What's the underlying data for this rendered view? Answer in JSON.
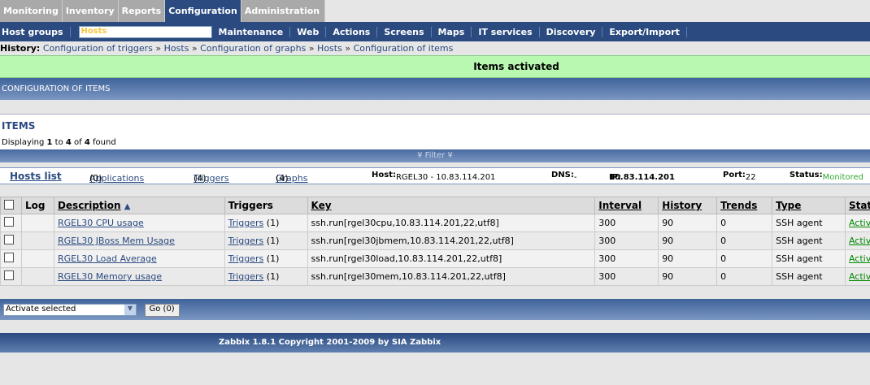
{
  "tabs": [
    "Monitoring",
    "Inventory",
    "Reports",
    "Configuration",
    "Administration"
  ],
  "subnav": [
    "Host groups",
    "Hosts",
    "Maintenance",
    "Web",
    "Actions",
    "Screens",
    "Maps",
    "IT services",
    "Discovery",
    "Export/Import"
  ],
  "history": {
    "label": "History:",
    "items": [
      "Configuration of triggers",
      "Hosts",
      "Configuration of graphs",
      "Hosts",
      "Configuration of items"
    ]
  },
  "message": "Items activated",
  "section_header": "CONFIGURATION OF ITEMS",
  "items_title": "ITEMS",
  "displaying": {
    "a": "Displaying ",
    "from": "1",
    "b": " to ",
    "to": "4",
    "c": " of ",
    "total": "4",
    "d": " found"
  },
  "filter": "¥  Filter  ¥",
  "hostinfo": {
    "hosts_list": "Hosts list",
    "applications": "Applications",
    "applications_count": "(0)",
    "triggers": "Triggers",
    "triggers_count": "(4)",
    "graphs": "Graphs",
    "graphs_count": "(4)",
    "host_label": "Host:",
    "host": "RGEL30 - 10.83.114.201",
    "dns_label": "DNS:",
    "dns": "-",
    "ip_label": "IP:",
    "ip": "10.83.114.201",
    "port_label": "Port:",
    "port": "22",
    "status_label": "Status:",
    "status": "Monitored"
  },
  "columns": [
    "Log",
    "Description",
    "Triggers",
    "Key",
    "Interval",
    "History",
    "Trends",
    "Type",
    "Status"
  ],
  "rows": [
    {
      "description": "RGEL30 CPU usage",
      "triggers": "Triggers",
      "tcount": "(1)",
      "key": "ssh.run[rgel30cpu,10.83.114.201,22,utf8]",
      "interval": "300",
      "history": "90",
      "trends": "0",
      "type": "SSH agent",
      "status": "Active"
    },
    {
      "description": "RGEL30 JBoss Mem Usage",
      "triggers": "Triggers",
      "tcount": "(1)",
      "key": "ssh.run[rgel30jbmem,10.83.114.201,22,utf8]",
      "interval": "300",
      "history": "90",
      "trends": "0",
      "type": "SSH agent",
      "status": "Active"
    },
    {
      "description": "RGEL30 Load Average",
      "triggers": "Triggers",
      "tcount": "(1)",
      "key": "ssh.run[rgel30load,10.83.114.201,22,utf8]",
      "interval": "300",
      "history": "90",
      "trends": "0",
      "type": "SSH agent",
      "status": "Active"
    },
    {
      "description": "RGEL30 Memory usage",
      "triggers": "Triggers",
      "tcount": "(1)",
      "key": "ssh.run[rgel30mem,10.83.114.201,22,utf8]",
      "interval": "300",
      "history": "90",
      "trends": "0",
      "type": "SSH agent",
      "status": "Active"
    }
  ],
  "action_select": "Activate selected",
  "go_button": "Go (0)",
  "footer": "Zabbix 1.8.1 Copyright 2001-2009 by SIA Zabbix"
}
